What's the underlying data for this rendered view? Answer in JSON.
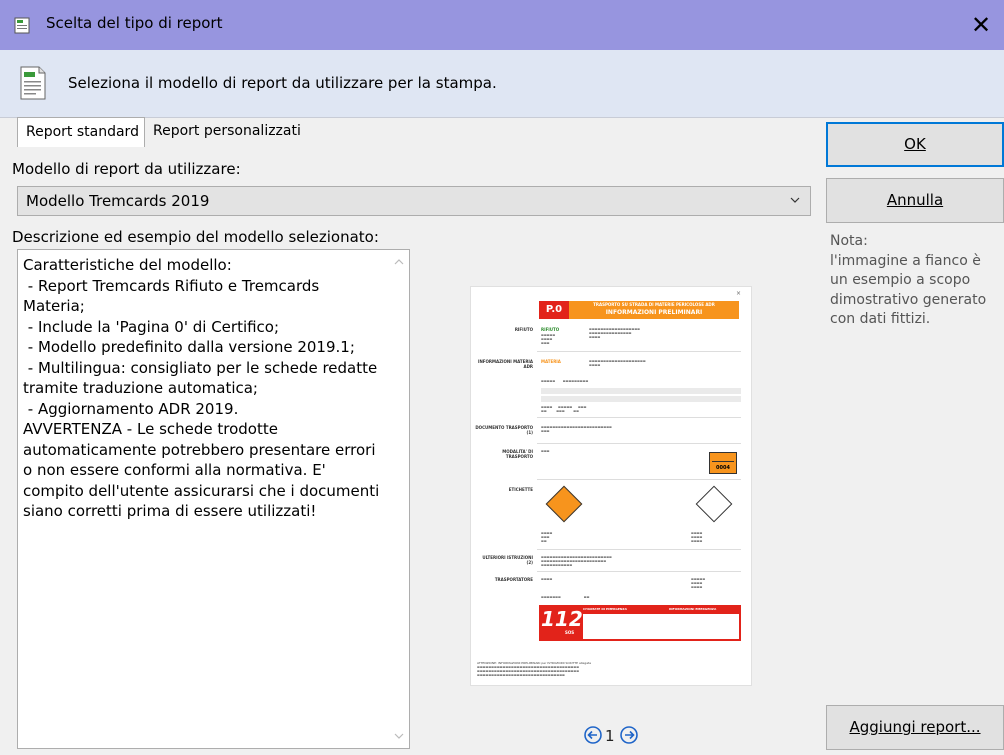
{
  "window": {
    "title": "Scelta del tipo di report",
    "close_glyph": "✕"
  },
  "header": {
    "text": "Seleziona il modello di report da utilizzare per la stampa."
  },
  "tabs": [
    {
      "label": "Report standard",
      "active": true
    },
    {
      "label": "Report personalizzati",
      "active": false
    }
  ],
  "model": {
    "label": "Modello di report da utilizzare:",
    "selected": "Modello Tremcards 2019"
  },
  "description": {
    "label": "Descrizione ed esempio del modello selezionato:",
    "text": "Caratteristiche del modello:\n - Report Tremcards Rifiuto e Tremcards Materia;\n - Include la 'Pagina 0' di Certifico;\n - Modello predefinito dalla versione 2019.1;\n - Multilingua: consigliato per le schede redatte tramite traduzione automatica;\n - Aggiornamento ADR 2019.\nAVVERTENZA - Le schede trodotte automaticamente potrebbero presentare errori o non essere conformi alla normativa. E' compito dell'utente assicurarsi che i documenti siano corretti prima di essere utilizzati!"
  },
  "preview": {
    "code": "P.0",
    "head_line1": "TRASPORTO SU STRADA DI MATERIE PERICOLOSE ADR",
    "head_line2": "INFORMAZIONI PRELIMINARI",
    "rows": {
      "rifiuto": "RIFIUTO",
      "info_materia": "INFORMAZIONI MATERIA ADR",
      "documento": "DOCUMENTO TRASPORTO (1)",
      "modalita": "MODALITA' DI TRASPORTO",
      "etichette": "ETICHETTE",
      "ulteriori": "ULTERIORI ISTRUZIONI (2)",
      "trasportatore": "TRASPORTATORE"
    },
    "green_label": "RIFIUTO",
    "orange_label": "MATERIA",
    "un_number": "0004",
    "emergency_number": "112",
    "emergency_sos": "SOS",
    "emergency_h1": "CHIAMATE DI EMERGENZA",
    "emergency_h2": "INFORMAZIONI EMERGENZA",
    "footer": "ATTENZIONE: INFORMAZIONI PRELIMINARI per ISTRUZIONI SCRITTE allegate"
  },
  "pager": {
    "page": "1"
  },
  "buttons": {
    "ok": "OK",
    "cancel": "Annulla",
    "add_report": "Aggiungi report..."
  },
  "note": "Nota:\nl'immagine a fianco è un esempio a scopo dimostrativo generato con dati fittizi.",
  "colors": {
    "titlebar": "#9795df",
    "header": "#dfe6f3",
    "accent": "#0078d7",
    "preview_red": "#e2231a",
    "preview_orange": "#f7941d"
  }
}
